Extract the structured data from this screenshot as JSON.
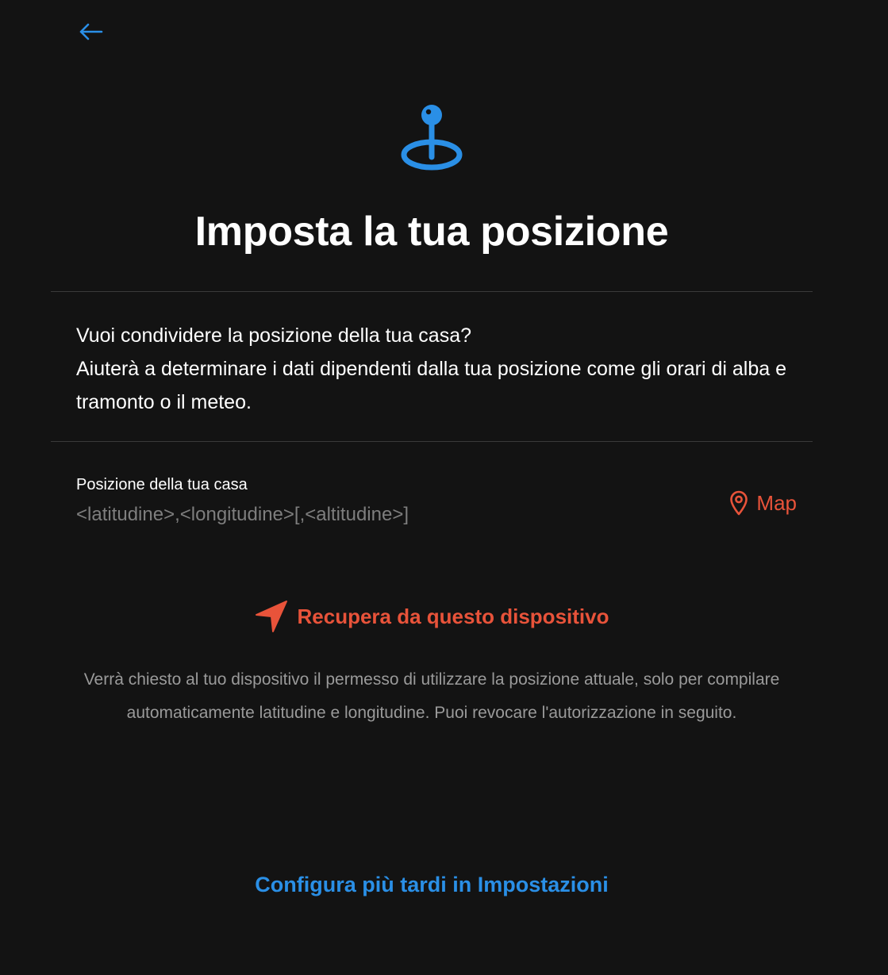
{
  "colors": {
    "background": "#131313",
    "accent_blue": "#2a8fe6",
    "accent_orange": "#e8533a",
    "muted_text": "#9a9a9a",
    "divider": "#3a3a3a"
  },
  "header": {
    "back_icon": "arrow-left-icon"
  },
  "hero": {
    "icon": "location-pin-target-icon",
    "title": "Imposta la tua posizione"
  },
  "description": {
    "line1": "Vuoi condividere la posizione della tua casa?",
    "line2": "Aiuterà a determinare i dati dipendenti dalla tua posizione come gli orari di alba e tramonto o il meteo."
  },
  "location_field": {
    "label": "Posizione della tua casa",
    "value": "",
    "placeholder": "<latitudine>,<longitudine>[,<altitudine>]"
  },
  "map_button": {
    "icon": "map-pin-icon",
    "label": "Map"
  },
  "fetch_button": {
    "icon": "navigation-arrow-icon",
    "label": "Recupera da questo dispositivo"
  },
  "hint": "Verrà chiesto al tuo dispositivo il permesso di utilizzare la posizione attuale, solo per compilare automaticamente latitudine e longitudine. Puoi revocare l'autorizzazione in seguito.",
  "later_link": "Configura più tardi in Impostazioni"
}
